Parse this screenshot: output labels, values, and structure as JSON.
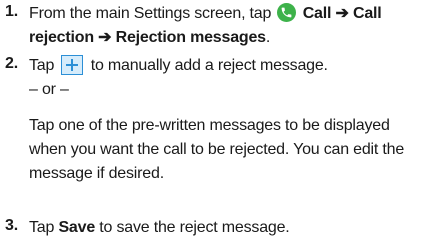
{
  "steps": [
    {
      "number": "1.",
      "text_before": "From the main Settings screen, tap",
      "icon": "phone-call-icon",
      "link1": "Call",
      "arrow1": "➔",
      "link2": "Call",
      "line2_link": "rejection",
      "arrow2": "➔",
      "link3": "Rejection messages",
      "end": "."
    },
    {
      "number": "2.",
      "text_before": "Tap",
      "icon": "plus-icon",
      "text_after": "to manually add a reject message.",
      "or_text": "– or –",
      "alt_lines": [
        "Tap one of the pre-written messages to be displayed",
        "when you want the call to be rejected. You can edit the",
        "message if desired."
      ]
    },
    {
      "number": "3.",
      "text_before": "Tap",
      "bold": "Save",
      "text_after": "to save the reject message."
    }
  ],
  "colors": {
    "call_icon": "#3db24a",
    "plus_icon_border": "#2c8fd6",
    "plus_icon_fill": "#d6ecfb"
  }
}
